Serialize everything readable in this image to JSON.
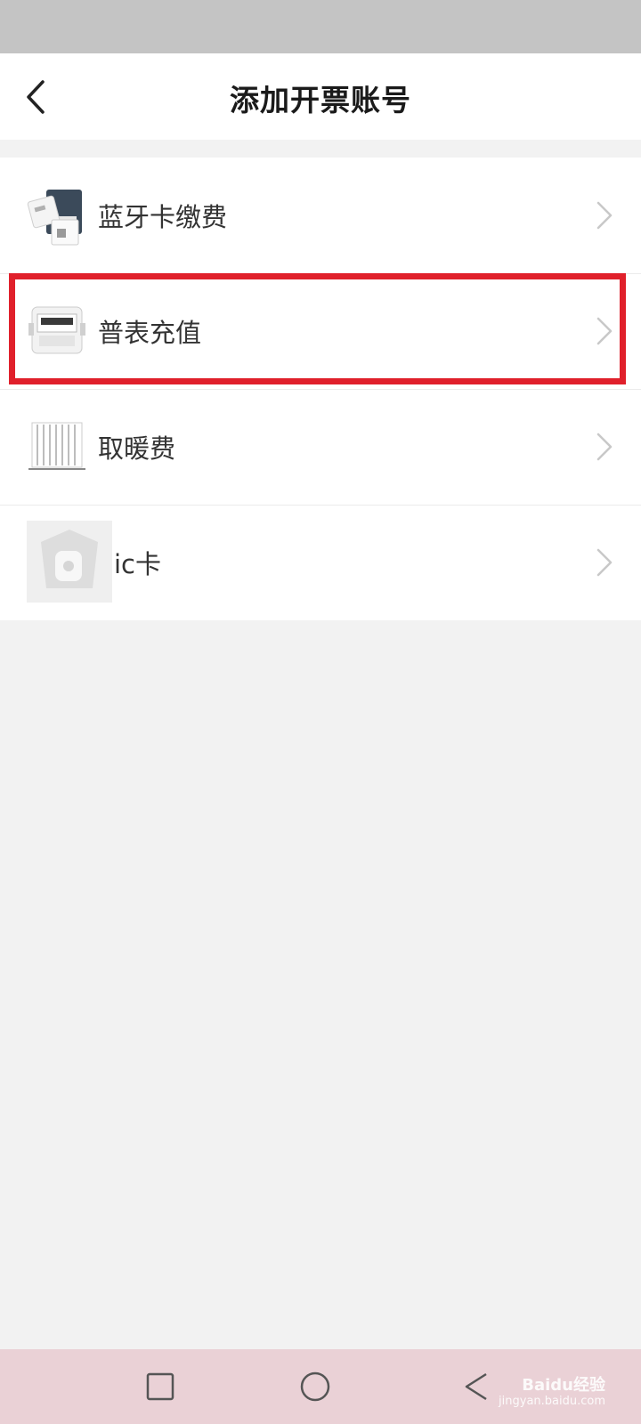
{
  "header": {
    "title": "添加开票账号"
  },
  "items": [
    {
      "label": "蓝牙卡缴费",
      "icon": "bluetooth-card-reader-icon"
    },
    {
      "label": "普表充值",
      "icon": "gas-meter-icon"
    },
    {
      "label": "取暖费",
      "icon": "radiator-icon"
    },
    {
      "label": "ic卡",
      "icon": "ic-card-icon"
    }
  ],
  "watermark": {
    "brand": "Baidu经验",
    "url": "jingyan.baidu.com"
  },
  "colors": {
    "highlight": "#e0202b",
    "background": "#f2f2f2",
    "navbar": "#ead1d6"
  }
}
